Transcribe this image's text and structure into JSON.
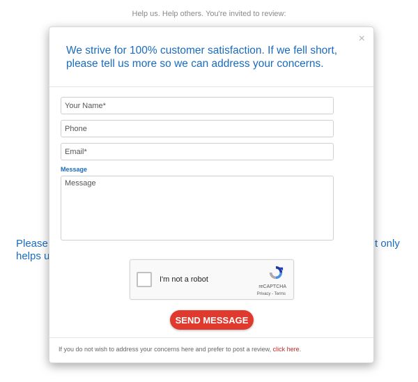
{
  "background": {
    "top_text": "Help us. Help others. You're invited to review:",
    "left_fragment": "Please\nhelps u",
    "right_fragment": "t only"
  },
  "modal": {
    "close_glyph": "×",
    "title": "We strive for 100% customer satisfaction. If we fell short, please tell us more so we can address your concerns.",
    "fields": {
      "name_placeholder": "Your Name*",
      "phone_placeholder": "Phone",
      "email_placeholder": "Email*",
      "message_label": "Message",
      "message_placeholder": "Message"
    },
    "captcha": {
      "label": "I'm not a robot",
      "brand": "reCAPTCHA",
      "privacy": "Privacy",
      "separator": " - ",
      "terms": "Terms"
    },
    "send_label": "SEND MESSAGE",
    "footer": {
      "text": "If you do not wish to address your concerns here and prefer to post a review, ",
      "link": "click here",
      "suffix": "."
    }
  },
  "colors": {
    "accent_blue": "#1a6bbd",
    "send_red": "#e03a2f",
    "link_red": "#c62828"
  }
}
